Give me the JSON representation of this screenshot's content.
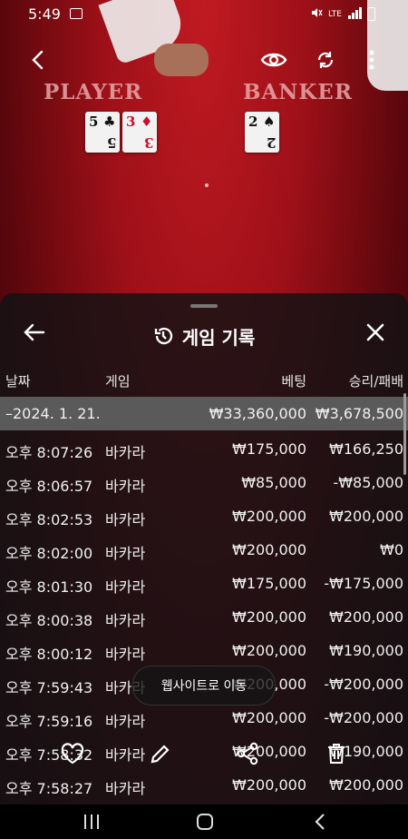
{
  "status_bar": {
    "time": "5:49",
    "right": "LTE"
  },
  "table": {
    "player": "PLAYER",
    "banker": "BANKER",
    "player_cards": [
      {
        "rank": "5",
        "suit": "♣",
        "color": "black"
      },
      {
        "rank": "3",
        "suit": "♦",
        "color": "red"
      }
    ],
    "banker_cards": [
      {
        "rank": "2",
        "suit": "♠",
        "color": "black"
      }
    ]
  },
  "panel": {
    "title": "게임 기록",
    "headers": {
      "date": "날짜",
      "game": "게임",
      "bet": "베팅",
      "result": "승리/패배"
    },
    "summary": {
      "date": "–2024. 1. 21.",
      "bet": "₩33,360,000",
      "result": "₩3,678,500"
    },
    "rows": [
      {
        "time": "오후 8:07:26",
        "game": "바카라",
        "bet": "₩175,000",
        "result": "₩166,250"
      },
      {
        "time": "오후 8:06:57",
        "game": "바카라",
        "bet": "₩85,000",
        "result": "-₩85,000"
      },
      {
        "time": "오후 8:02:53",
        "game": "바카라",
        "bet": "₩200,000",
        "result": "₩200,000"
      },
      {
        "time": "오후 8:02:00",
        "game": "바카라",
        "bet": "₩200,000",
        "result": "₩0"
      },
      {
        "time": "오후 8:01:30",
        "game": "바카라",
        "bet": "₩175,000",
        "result": "-₩175,000"
      },
      {
        "time": "오후 8:00:38",
        "game": "바카라",
        "bet": "₩200,000",
        "result": "₩200,000"
      },
      {
        "time": "오후 8:00:12",
        "game": "바카라",
        "bet": "₩200,000",
        "result": "₩190,000"
      },
      {
        "time": "오후 7:59:43",
        "game": "바카라",
        "bet": "₩200,000",
        "result": "-₩200,000"
      },
      {
        "time": "오후 7:59:16",
        "game": "바카라",
        "bet": "₩200,000",
        "result": "-₩200,000"
      },
      {
        "time": "오후 7:58:32",
        "game": "바카라",
        "bet": "₩200,000",
        "result": "₩190,000"
      },
      {
        "time": "오후 7:58:27",
        "game": "바카라",
        "bet": "₩200,000",
        "result": "₩200,000"
      }
    ]
  },
  "overlay": {
    "website_button": "웹사이트로 이동",
    "icons": [
      "heart-icon",
      "pencil-icon",
      "share-icon",
      "trash-icon"
    ]
  },
  "colors": {
    "felt": "#9e1018",
    "summary_row": "#5a5a5a"
  }
}
